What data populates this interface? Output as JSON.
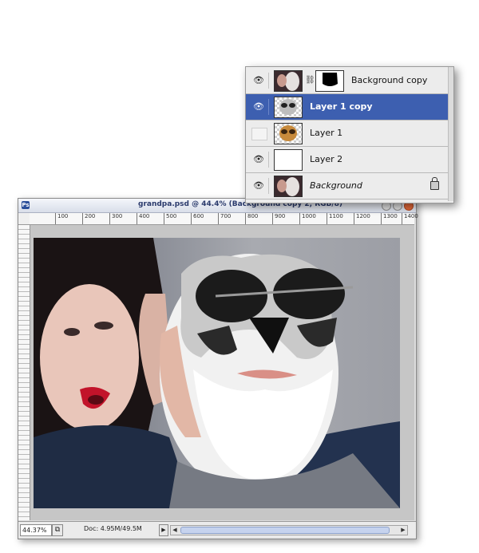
{
  "document": {
    "title": "grandpa.psd @ 44.4% (Background copy 2, RGB/8)",
    "app_icon_label": "Ps",
    "ruler_ticks": [
      "100",
      "200",
      "300",
      "400",
      "500",
      "600",
      "700",
      "800",
      "900",
      "1000",
      "1100",
      "1200",
      "1300",
      "1400"
    ],
    "zoom_level": "44.37%",
    "doc_size": "Doc: 4.95M/49.5M"
  },
  "layers": [
    {
      "name": "Background copy",
      "visible": true,
      "selected": false,
      "has_mask": true,
      "locked": false,
      "italic": false
    },
    {
      "name": "Layer 1 copy",
      "visible": true,
      "selected": true,
      "has_mask": false,
      "locked": false,
      "italic": false
    },
    {
      "name": "Layer 1",
      "visible": false,
      "selected": false,
      "has_mask": false,
      "locked": false,
      "italic": false
    },
    {
      "name": "Layer 2",
      "visible": true,
      "selected": false,
      "has_mask": false,
      "locked": false,
      "italic": false
    },
    {
      "name": "Background",
      "visible": true,
      "selected": false,
      "has_mask": false,
      "locked": true,
      "italic": true
    }
  ],
  "colors": {
    "selection": "#3d5fb0",
    "title_text": "#2a3a6c"
  }
}
